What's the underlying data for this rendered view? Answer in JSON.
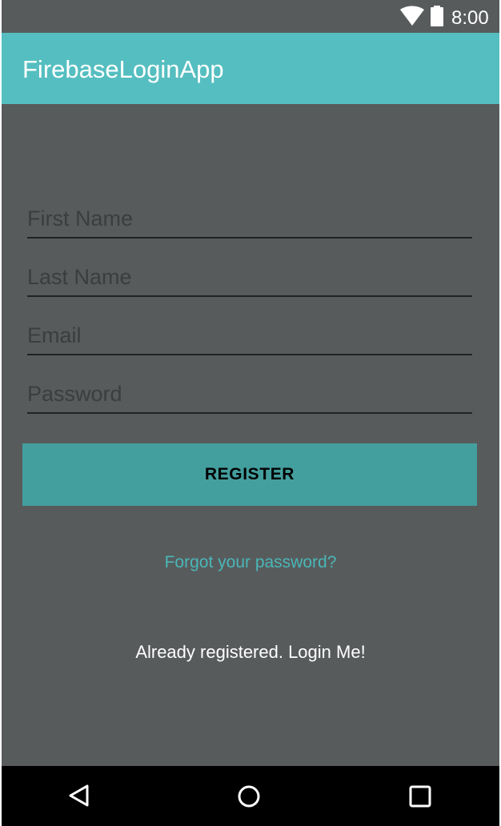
{
  "status_bar": {
    "time": "8:00",
    "icons": [
      "wifi-icon",
      "battery-icon"
    ]
  },
  "app_bar": {
    "title": "FirebaseLoginApp"
  },
  "form": {
    "first_name": {
      "value": "",
      "placeholder": "First Name"
    },
    "last_name": {
      "value": "",
      "placeholder": "Last Name"
    },
    "email": {
      "value": "",
      "placeholder": "Email"
    },
    "password": {
      "value": "",
      "placeholder": "Password"
    },
    "register_label": "REGISTER",
    "forgot_password_label": "Forgot your password?",
    "login_label": "Already registered. Login Me!"
  },
  "navigation_bar": {
    "icons": [
      "back-icon",
      "home-icon",
      "recents-icon"
    ]
  },
  "colors": {
    "background": "#585b5c",
    "app_bar": "#55bec0",
    "button": "#439f9e",
    "link": "#4ab7b8",
    "field_underline": "#202223",
    "navigation_bar": "#000000"
  }
}
